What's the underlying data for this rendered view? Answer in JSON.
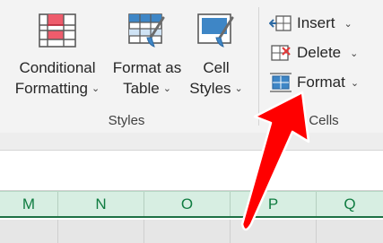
{
  "ribbon": {
    "styles_group": {
      "label": "Styles",
      "conditional_formatting": {
        "line1": "Conditional",
        "line2": "Formatting",
        "caret": "⌄"
      },
      "format_as_table": {
        "line1": "Format as",
        "line2": "Table",
        "caret": "⌄"
      },
      "cell_styles": {
        "line1": "Cell",
        "line2": "Styles",
        "caret": "⌄"
      }
    },
    "cells_group": {
      "label": "Cells",
      "insert": {
        "label": "Insert",
        "caret": "⌄"
      },
      "delete": {
        "label": "Delete",
        "caret": "⌄"
      },
      "format": {
        "label": "Format",
        "caret": "⌄"
      }
    }
  },
  "sheet": {
    "columns": [
      "M",
      "N",
      "O",
      "P",
      "Q"
    ]
  },
  "annotation": {
    "icon": "red-arrow-icon",
    "color": "#ff0000"
  },
  "colors": {
    "accent": "#107c41",
    "header_bg": "#d7eee2",
    "ribbon_bg": "#f3f3f3"
  }
}
